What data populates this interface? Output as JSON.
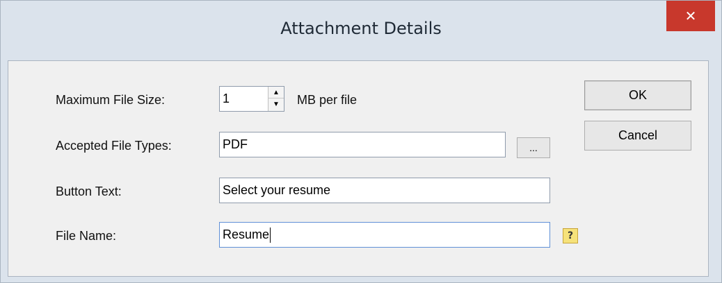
{
  "window": {
    "title": "Attachment Details",
    "close_glyph": "✕"
  },
  "fields": {
    "max_size_label": "Maximum File Size:",
    "max_size_value": "1",
    "max_size_unit": "MB per file",
    "types_label": "Accepted File Types:",
    "types_value": "PDF",
    "browse_label": "...",
    "button_text_label": "Button Text:",
    "button_text_value": "Select your resume",
    "file_name_label": "File Name:",
    "file_name_value": "Resume",
    "help_glyph": "?"
  },
  "actions": {
    "ok_label": "OK",
    "cancel_label": "Cancel"
  },
  "icons": {
    "spin_up": "▲",
    "spin_down": "▼"
  },
  "colors": {
    "close": "#c8382c",
    "titlebar": "#dbe3ec",
    "client": "#f0f0f0"
  }
}
